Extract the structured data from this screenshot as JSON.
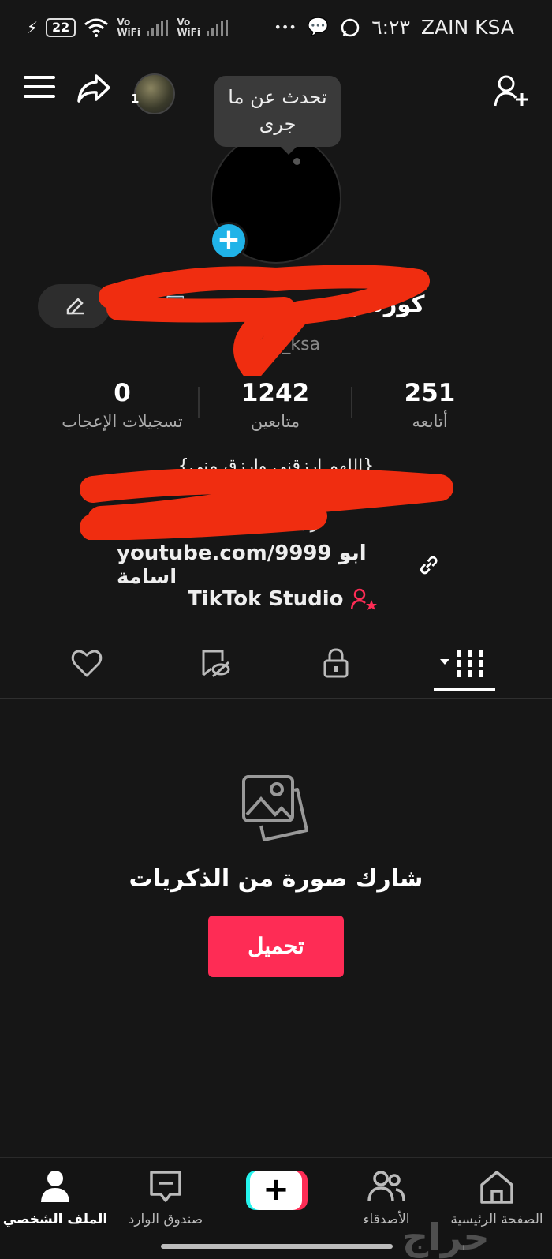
{
  "status_bar": {
    "battery": "22",
    "vowifi_1": "Vo WiFi",
    "vowifi_2": "Vo WiFi",
    "dots": "•••",
    "time": "٦:٢٣",
    "carrier": "ZAIN KSA"
  },
  "header": {
    "avatar_count": "1",
    "tooltip": "تحدث عن ما جرى"
  },
  "profile": {
    "name": "كورسو",
    "username": "orso_ksa",
    "stats": [
      {
        "value": "251",
        "label": "أتابعه"
      },
      {
        "value": "1242",
        "label": "متابعين"
      },
      {
        "value": "0",
        "label": "تسجيلات الإعجاب"
      }
    ],
    "bio_line1": "{اللهم ارزقني وارزق مني}",
    "bio_line2": "رابط قروبي",
    "link": "youtube.com/9999 ابو اسامة",
    "studio": "TikTok Studio"
  },
  "tabs": [
    "posts",
    "private",
    "reposts",
    "liked"
  ],
  "empty_state": {
    "title": "شارك صورة من الذكريات",
    "button": "تحميل"
  },
  "bottom_nav": {
    "profile": "الملف الشخصي",
    "inbox": "صندوق الوارد",
    "friends": "الأصدقاء",
    "home": "الصفحة الرئيسية"
  },
  "watermark": "حراج",
  "colors": {
    "accent": "#fe2c55",
    "add_photo": "#20b3e8",
    "background": "#161616"
  }
}
